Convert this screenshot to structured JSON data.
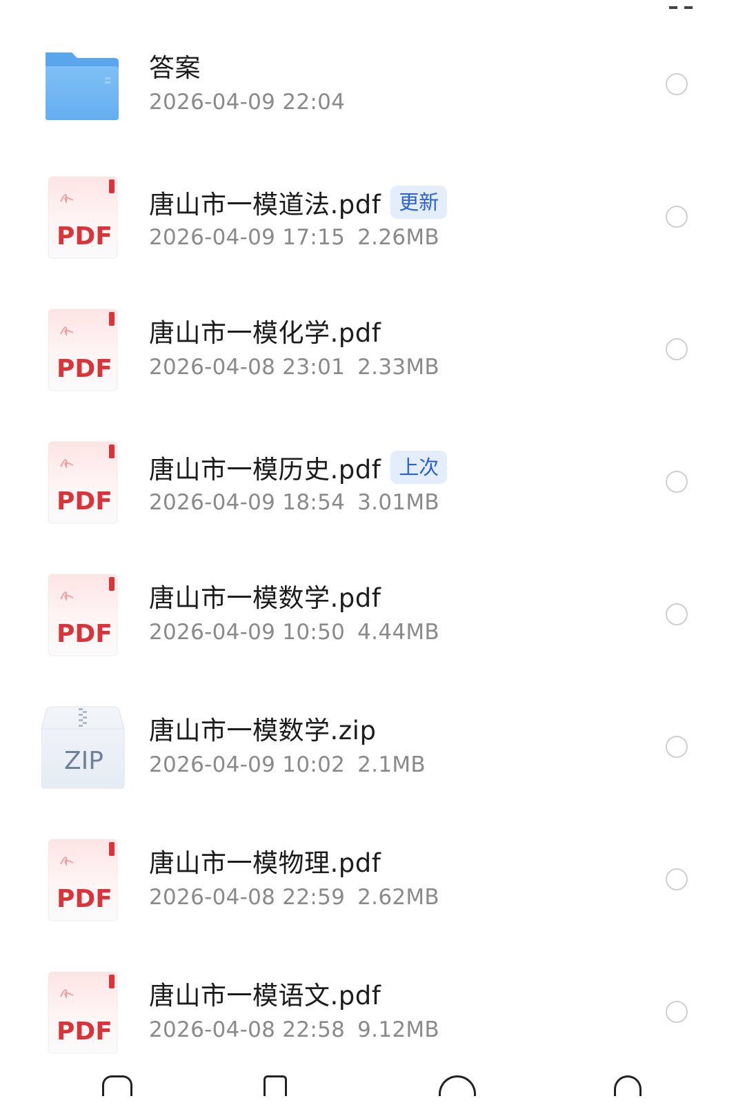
{
  "files": [
    {
      "type": "folder",
      "name": "答案",
      "meta": "2026-04-09 22:04",
      "size": "",
      "badge": ""
    },
    {
      "type": "pdf",
      "name": "唐山市一模道法.pdf",
      "meta": "2026-04-09 17:15",
      "size": "2.26MB",
      "badge": "更新"
    },
    {
      "type": "pdf",
      "name": "唐山市一模化学.pdf",
      "meta": "2026-04-08 23:01",
      "size": "2.33MB",
      "badge": ""
    },
    {
      "type": "pdf",
      "name": "唐山市一模历史.pdf",
      "meta": "2026-04-09 18:54",
      "size": "3.01MB",
      "badge": "上次"
    },
    {
      "type": "pdf",
      "name": "唐山市一模数学.pdf",
      "meta": "2026-04-09 10:50",
      "size": "4.44MB",
      "badge": ""
    },
    {
      "type": "zip",
      "name": "唐山市一模数学.zip",
      "meta": "2026-04-09 10:02",
      "size": "2.1MB",
      "badge": ""
    },
    {
      "type": "pdf",
      "name": "唐山市一模物理.pdf",
      "meta": "2026-04-08 22:59",
      "size": "2.62MB",
      "badge": ""
    },
    {
      "type": "pdf",
      "name": "唐山市一模语文.pdf",
      "meta": "2026-04-08 22:58",
      "size": "9.12MB",
      "badge": ""
    }
  ],
  "icon_labels": {
    "pdf": "PDF",
    "zip": "ZIP"
  },
  "colors": {
    "pdf_red": "#d9343a",
    "folder_blue": "#6fb5f2",
    "badge_bg": "#e3edfb",
    "badge_text": "#2a62d6"
  }
}
